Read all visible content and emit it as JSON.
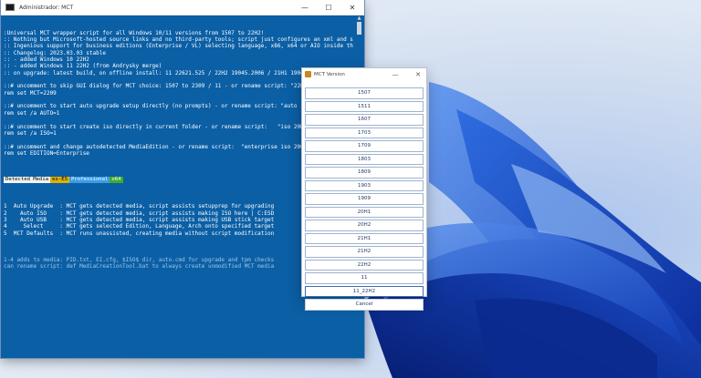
{
  "console": {
    "title": "Administrador: MCT",
    "controls": {
      "minimize": "—",
      "maximize": "☐",
      "close": "✕"
    },
    "lines": [
      ":Universal MCT wrapper script for all Windows 10/11 versions from 1507 to 22H2!",
      ":: Nothing but Microsoft-hosted source links and no third-party tools; script just configures an xml and starts MCT",
      ":: Ingenious support for business editions (Enterprise / VL) selecting language, x86, x64 or AIO inside the MCT GUI",
      ":: Changelog: 2023.03.03 stable",
      ":: - added Windows 10 22H2",
      ":: - added Windows 11 22H2 (from Andrysky merge)",
      ":: on upgrade: latest build, on offline install: 11 22621.525 / 22H2 19045.2006 / 21H1 19043.1348 / 20H2 19042.1052",
      "",
      "::# uncomment to skip GUI dialog for MCT choice: 1507 to 2309 / 11 - or rename script: \"22H2 MediaCreationTool.bat\"",
      "rem set MCT=2209",
      "",
      "::# uncomment to start auto upgrade setup directly (no prompts) - or rename script: \"auto 11 MediaCre",
      "rem set /a AUTO=1",
      "",
      "::# uncomment to start create iso directly in current folder - or rename script:   \"iso 20H2 MediaCre",
      "rem set /a ISO=1",
      "",
      "::# uncomment and change autodetected MediaEdition - or rename script:  \"enterprise iso 2009 MediaCre",
      "rem set EDITION=Enterprise",
      ""
    ],
    "badges": {
      "detected": "Detected Media",
      "lang": "es-ES",
      "edition": "Professional",
      "arch": "x64"
    },
    "menu": [
      "",
      "1  Auto Upgrade  : MCT gets detected media, script assists setupprep for upgrading",
      "2    Auto ISO    : MCT gets detected media, script assists making ISO here | C:ESD",
      "3    Auto USB    : MCT gets detected media, script assists making USB stick target",
      "4     Select     : MCT gets selected Edition, Language, Arch onto specified target",
      "5  MCT Defaults  : MCT runs unassisted, creating media without script modification",
      ""
    ],
    "footer": [
      "1-4 adds to media: PID.txt, EI.cfg, $ISO$ dir, auto.cmd for upgrade and tpm checks",
      "can rename script: def MediaCreationTool.bat to always create unmodified MCT media"
    ]
  },
  "dialog": {
    "title": "MCT Version",
    "controls": {
      "minimize": "—",
      "close": "✕"
    },
    "options": [
      "1507",
      "1511",
      "1607",
      "1703",
      "1709",
      "1803",
      "1809",
      "1903",
      "1909",
      "20H1",
      "20H2",
      "21H1",
      "21H2",
      "22H2",
      "11",
      "11_22H2",
      "Cancel"
    ],
    "selected": "11_22H2"
  },
  "colors": {
    "console_bg": "#0b5fa5",
    "accent": "#3c6fb5"
  }
}
